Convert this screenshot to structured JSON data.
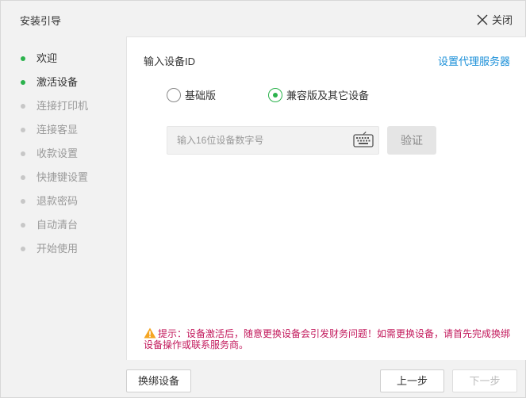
{
  "window": {
    "title": "安装引导",
    "close_label": "关闭"
  },
  "sidebar": {
    "steps": [
      {
        "label": "欢迎",
        "status": "done"
      },
      {
        "label": "激活设备",
        "status": "done"
      },
      {
        "label": "连接打印机",
        "status": "pending"
      },
      {
        "label": "连接客显",
        "status": "pending"
      },
      {
        "label": "收款设置",
        "status": "pending"
      },
      {
        "label": "快捷键设置",
        "status": "pending"
      },
      {
        "label": "退款密码",
        "status": "pending"
      },
      {
        "label": "自动清台",
        "status": "pending"
      },
      {
        "label": "开始使用",
        "status": "pending"
      }
    ]
  },
  "main": {
    "section_label": "输入设备ID",
    "proxy_link": "设置代理服务器",
    "edition_options": [
      {
        "label": "基础版",
        "checked": false
      },
      {
        "label": "兼容版及其它设备",
        "checked": true
      }
    ],
    "device_id_input": {
      "value": "",
      "placeholder": "输入16位设备数字号"
    },
    "verify_label": "验证",
    "warning_text": "提示：设备激活后，随意更换设备会引发财务问题！如需更换设备，请首先完成换绑设备操作或联系服务商。"
  },
  "footer": {
    "rebind_label": "换绑设备",
    "prev_label": "上一步",
    "next_label": "下一步"
  },
  "colors": {
    "accent_green": "#2bb24c",
    "link_blue": "#1a8fd8",
    "warning_text": "#c2185b",
    "warning_icon": "#f5a623"
  }
}
